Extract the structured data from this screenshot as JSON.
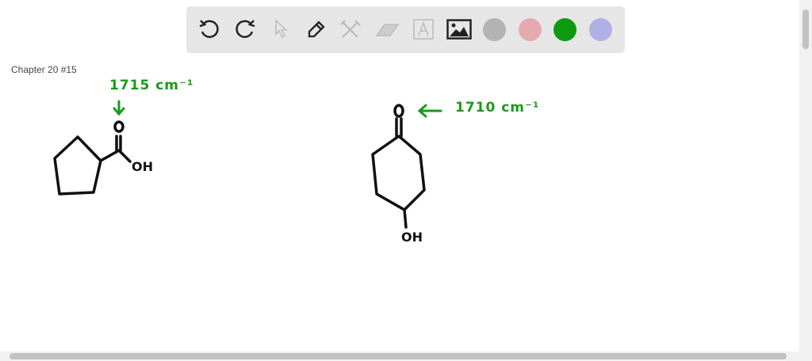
{
  "toolbar": {
    "tools": [
      "undo-icon",
      "redo-icon",
      "select-icon",
      "pen-icon",
      "tools-icon",
      "eraser-icon",
      "text-icon",
      "image-icon"
    ],
    "colors": [
      "#b3b3b3",
      "#e6a9ae",
      "#0e9a0e",
      "#b0b0e6"
    ]
  },
  "page": {
    "title": "Chapter 20 #15"
  },
  "drawing": {
    "left_ir": "1715 cm⁻¹",
    "right_ir": "1710 cm⁻¹",
    "left_o": "O",
    "left_oh": "OH",
    "right_o": "O",
    "right_oh": "OH",
    "arrow_left": "←"
  }
}
